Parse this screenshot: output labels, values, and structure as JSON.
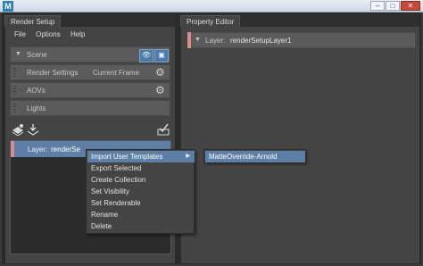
{
  "window": {
    "icon_letter": "M",
    "minimize": "–",
    "maximize": "□",
    "close": "✕"
  },
  "render_setup": {
    "tab_label": "Render Setup",
    "menu": [
      "File",
      "Options",
      "Help"
    ],
    "scene_label": "Scene",
    "render_settings_label": "Render Settings",
    "render_settings_value": "Current Frame",
    "aovs_label": "AOVs",
    "lights_label": "Lights",
    "layer_prefix": "Layer:",
    "layer_name": "renderSe"
  },
  "property_editor": {
    "tab_label": "Property Editor",
    "layer_prefix": "Layer:",
    "layer_name": "renderSetupLayer1"
  },
  "context_menu": {
    "items": [
      "Import User Templates",
      "Export Selected",
      "Create Collection",
      "Set Visibility",
      "Set Renderable",
      "Rename",
      "Delete"
    ],
    "submenu_arrow": "▶"
  },
  "submenu": {
    "items": [
      "MatteOverride-Arnold"
    ]
  },
  "icons": {
    "collapse": "▼",
    "gear": "⚙",
    "eye": "👁",
    "camera": "▣",
    "check": "✓"
  },
  "colors": {
    "accent": "#5d7fa5",
    "layer_tag": "#d78d8d"
  }
}
